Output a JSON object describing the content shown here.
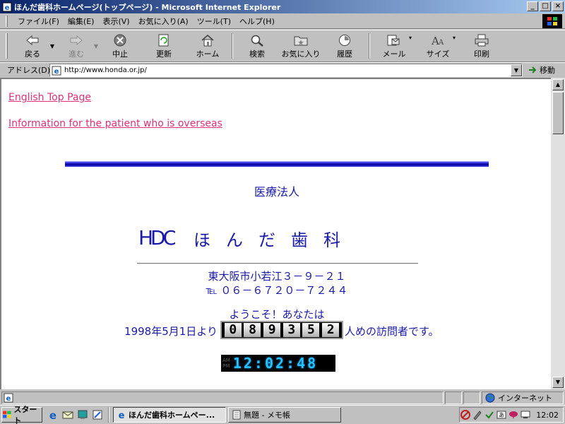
{
  "window": {
    "title": "ほんだ歯科ホームページ(トップページ) - Microsoft Internet Explorer",
    "minimize": "_",
    "maximize": "□",
    "close": "×"
  },
  "menu": [
    "ファイル(F)",
    "編集(E)",
    "表示(V)",
    "お気に入り(A)",
    "ツール(T)",
    "ヘルプ(H)"
  ],
  "toolbar": {
    "back": "戻る",
    "forward": "進む",
    "stop": "中止",
    "refresh": "更新",
    "home": "ホーム",
    "search": "検索",
    "favorites": "お気に入り",
    "history": "履歴",
    "mail": "メール",
    "size": "サイズ",
    "print": "印刷"
  },
  "address": {
    "label": "アドレス(D)",
    "url": "http://www.honda.or.jp/",
    "go": "移動"
  },
  "page": {
    "link_english": "English Top Page",
    "link_overseas": "Information for the patient who is overseas",
    "corp_type": "医療法人",
    "logo_text": "HDC",
    "clinic_name": "ほんだ歯科",
    "address": "東大阪市小若江３－９－２１",
    "phone": "℡ ０６－６７２０－７２４４",
    "welcome": "ようこそ！あなたは",
    "since": "1998年5月1日より",
    "counter_digits": [
      "0",
      "8",
      "9",
      "3",
      "5",
      "2"
    ],
    "visitor_suffix": "人めの訪問者です。",
    "clock_ampm": [
      "AM",
      "PM"
    ],
    "clock": "12:02:48"
  },
  "status": {
    "zone": "インターネット"
  },
  "taskbar": {
    "start": "スタート",
    "tasks": [
      {
        "label": "ほんだ歯科ホームペー...",
        "active": true
      },
      {
        "label": "無題 - メモ帳",
        "active": false
      }
    ],
    "time": "12:02"
  },
  "colors": {
    "link": "#e0307a",
    "text_blue": "#1a1aa8",
    "clock_digit": "#2ac0ff"
  }
}
